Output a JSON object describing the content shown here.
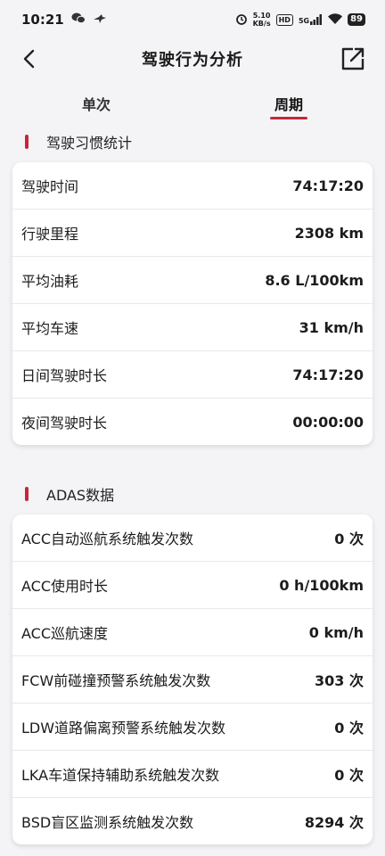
{
  "status": {
    "time": "10:21",
    "net_speed_top": "5.10",
    "net_speed_bottom": "KB/s",
    "hd": "HD",
    "signal": "5G",
    "battery": "89"
  },
  "header": {
    "title": "驾驶行为分析"
  },
  "tabs": [
    {
      "label": "单次",
      "active": false
    },
    {
      "label": "周期",
      "active": true
    }
  ],
  "habits": {
    "title": "驾驶习惯统计",
    "rows": [
      {
        "label": "驾驶时间",
        "value": "74:17:20"
      },
      {
        "label": "行驶里程",
        "value": "2308 km"
      },
      {
        "label": "平均油耗",
        "value": "8.6 L/100km"
      },
      {
        "label": "平均车速",
        "value": "31 km/h"
      },
      {
        "label": "日间驾驶时长",
        "value": "74:17:20"
      },
      {
        "label": "夜间驾驶时长",
        "value": "00:00:00"
      }
    ]
  },
  "adas": {
    "title": "ADAS数据",
    "rows": [
      {
        "label": "ACC自动巡航系统触发次数",
        "value": "0 次"
      },
      {
        "label": "ACC使用时长",
        "value": "0 h/100km"
      },
      {
        "label": "ACC巡航速度",
        "value": "0 km/h"
      },
      {
        "label": "FCW前碰撞预警系统触发次数",
        "value": "303 次"
      },
      {
        "label": "LDW道路偏离预警系统触发次数",
        "value": "0 次"
      },
      {
        "label": "LKA车道保持辅助系统触发次数",
        "value": "0 次"
      },
      {
        "label": "BSD盲区监测系统触发次数",
        "value": "8294 次"
      }
    ]
  },
  "colors": {
    "accent": "#c8253a",
    "background": "#f4f4f6"
  }
}
